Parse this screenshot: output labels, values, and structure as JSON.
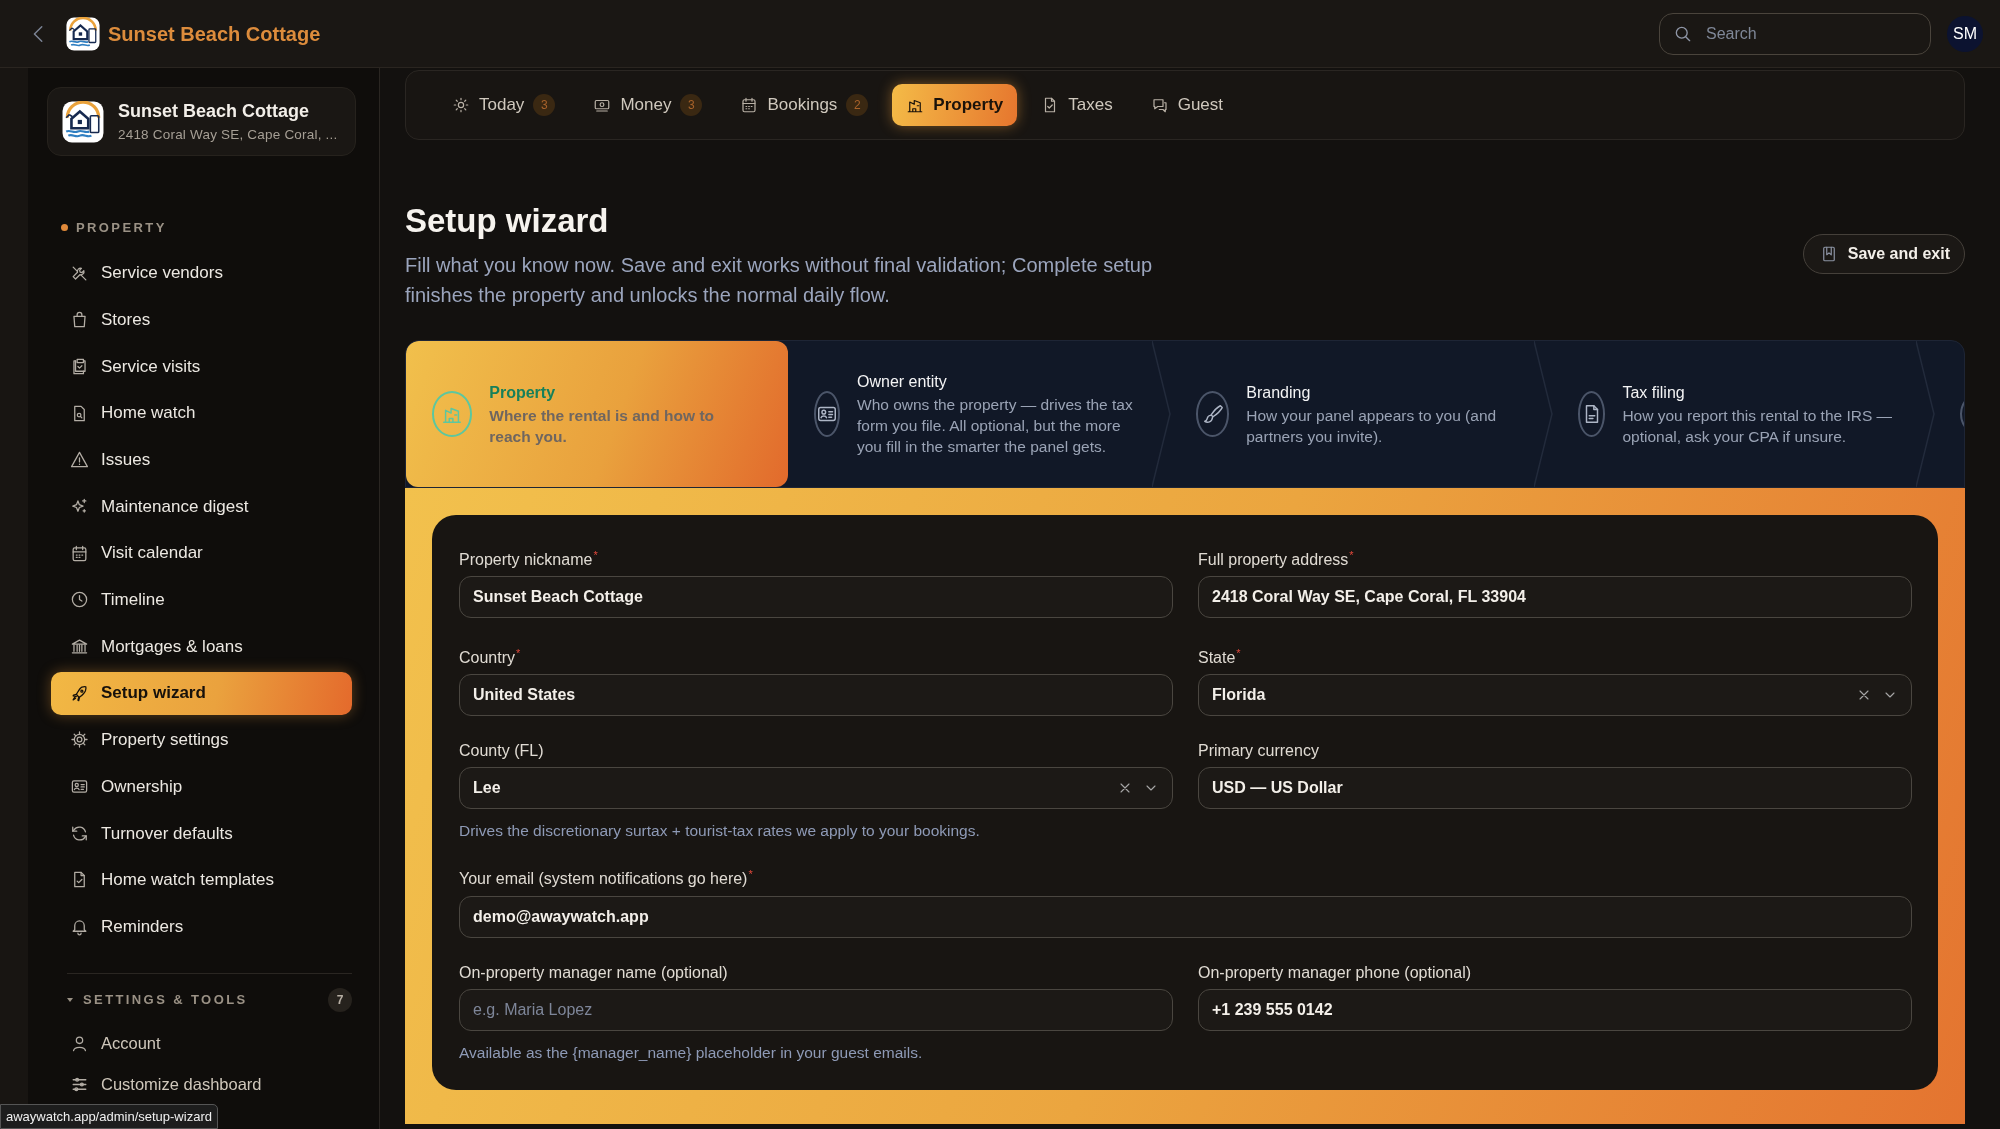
{
  "topbar": {
    "title": "Sunset Beach Cottage",
    "search": {
      "placeholder": "Search"
    },
    "avatar": "SM"
  },
  "sidebar": {
    "property": {
      "name": "Sunset Beach Cottage",
      "address": "2418 Coral Way SE, Cape Coral, ..."
    },
    "section": "PROPERTY",
    "items": [
      {
        "label": "Service vendors",
        "selected": false
      },
      {
        "label": "Stores",
        "selected": false
      },
      {
        "label": "Service visits",
        "selected": false
      },
      {
        "label": "Home watch",
        "selected": false
      },
      {
        "label": "Issues",
        "selected": false
      },
      {
        "label": "Maintenance digest",
        "selected": false
      },
      {
        "label": "Visit calendar",
        "selected": false
      },
      {
        "label": "Timeline",
        "selected": false
      },
      {
        "label": "Mortgages & loans",
        "selected": false
      },
      {
        "label": "Setup wizard",
        "selected": true
      },
      {
        "label": "Property settings",
        "selected": false
      },
      {
        "label": "Ownership",
        "selected": false
      },
      {
        "label": "Turnover defaults",
        "selected": false
      },
      {
        "label": "Home watch templates",
        "selected": false
      },
      {
        "label": "Reminders",
        "selected": false
      }
    ],
    "settings": {
      "title": "SETTINGS & TOOLS",
      "count": "7",
      "expanded": true,
      "items": [
        {
          "label": "Account",
          "selected": false
        },
        {
          "label": "Customize dashboard",
          "selected": false
        }
      ]
    }
  },
  "tabs": [
    {
      "label": "Today",
      "badge": "3",
      "selected": false
    },
    {
      "label": "Money",
      "badge": "3",
      "selected": false
    },
    {
      "label": "Bookings",
      "badge": "2",
      "selected": false
    },
    {
      "label": "Property",
      "selected": true
    },
    {
      "label": "Taxes",
      "selected": false
    },
    {
      "label": "Guest",
      "selected": false
    }
  ],
  "page": {
    "title": "Setup wizard",
    "subtitle": "Fill what you know now. Save and exit works without final validation; Complete setup finishes the property and unlocks the normal daily flow.",
    "save_button": "Save and exit"
  },
  "steps": [
    {
      "title": "Property",
      "description": "Where the rental is and how to reach you.",
      "selected": true
    },
    {
      "title": "Owner entity",
      "description": "Who owns the property — drives the tax form you file. All optional, but the more you fill in the smarter the panel gets.",
      "selected": false
    },
    {
      "title": "Branding",
      "description": "How your panel appears to you (and partners you invite).",
      "selected": false
    },
    {
      "title": "Tax filing",
      "description": "How you report this rental to the IRS — optional, ask your CPA if unsure.",
      "selected": false
    },
    {
      "selected": false
    }
  ],
  "form": {
    "rows": [
      {
        "fields": [
          {
            "label": "Property nickname",
            "required_mark": "*",
            "kind": "text",
            "value": "Sunset Beach Cottage"
          },
          {
            "label": "Full property address",
            "required_mark": "*",
            "kind": "text",
            "value": "2418 Coral Way SE, Cape Coral, FL 33904"
          }
        ]
      },
      {
        "fields": [
          {
            "label": "Country",
            "required_mark": "*",
            "kind": "text",
            "value": "United States"
          },
          {
            "label": "State",
            "required_mark": "*",
            "kind": "select",
            "value": "Florida"
          }
        ]
      },
      {
        "fields": [
          {
            "label": "County (FL)",
            "kind": "select",
            "value": "Lee"
          },
          {
            "label": "Primary currency",
            "kind": "text",
            "value": "USD — US Dollar"
          }
        ],
        "hint": "Drives the discretionary surtax + tourist-tax rates we apply to your bookings."
      },
      {
        "fields": [
          {
            "label": "Your email (system notifications go here)",
            "required_mark": "*",
            "kind": "text",
            "value": "demo@awaywatch.app"
          }
        ]
      },
      {
        "fields": [
          {
            "label": "On-property manager name (optional)",
            "kind": "text",
            "placeholder": "e.g. Maria Lopez"
          },
          {
            "label": "On-property manager phone (optional)",
            "kind": "text",
            "value": "+1 239 555 0142"
          }
        ],
        "hint": "Available as the {manager_name} placeholder in your guest emails."
      }
    ]
  },
  "status_url": "awaywatch.app/admin/setup-wizard"
}
